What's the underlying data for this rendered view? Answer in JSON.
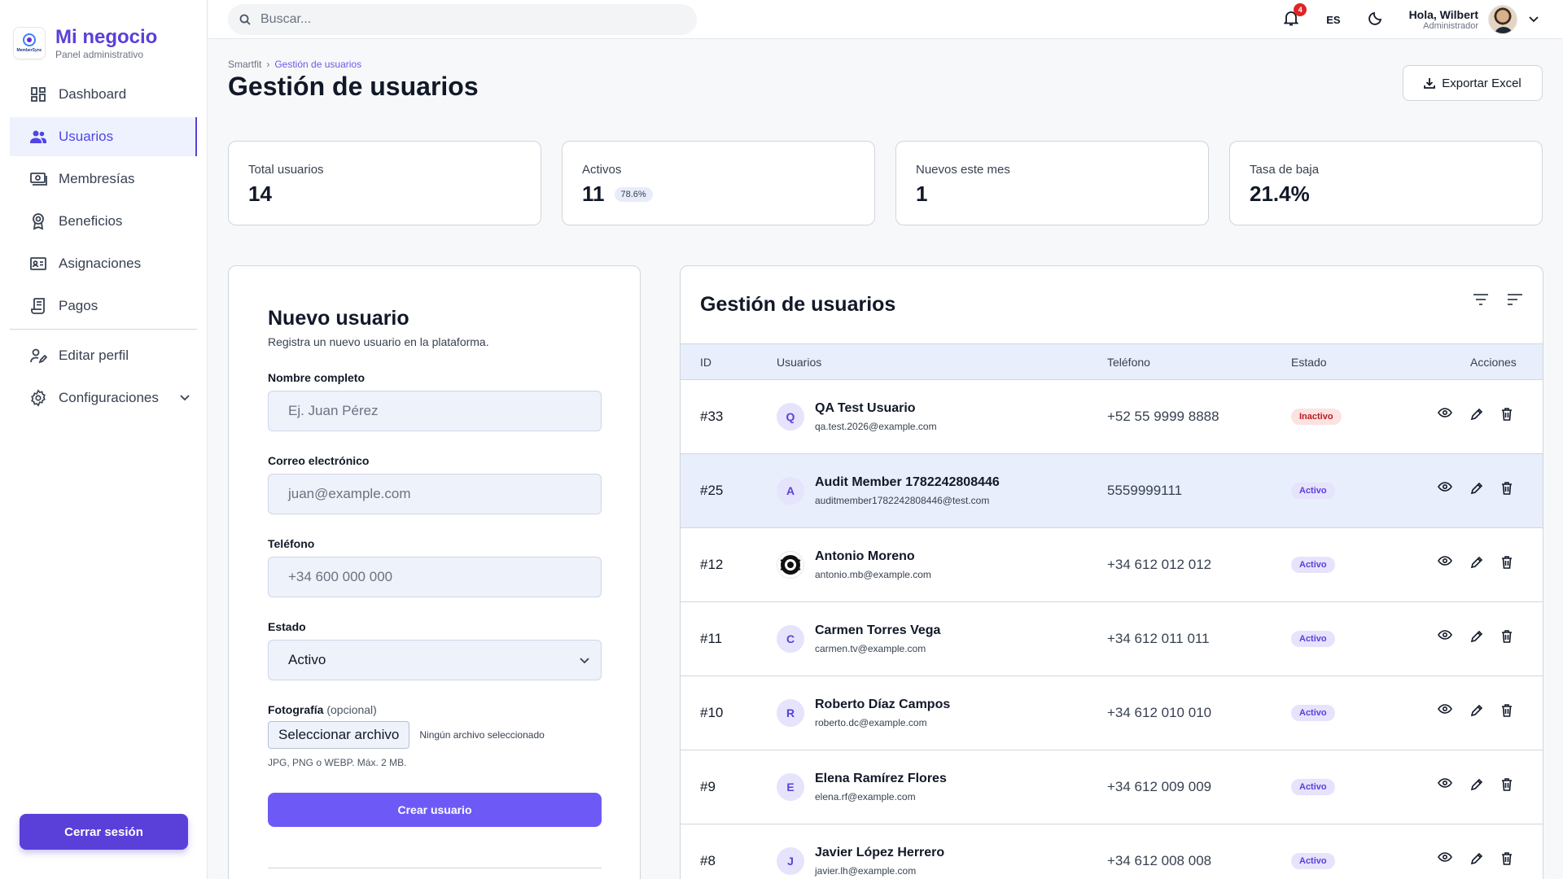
{
  "brand": {
    "title": "Mi negocio",
    "subtitle": "Panel administrativo",
    "logo_text": "MemberSync"
  },
  "sidebar": {
    "items": [
      {
        "label": "Dashboard",
        "icon": "dashboard-icon",
        "active": false
      },
      {
        "label": "Usuarios",
        "icon": "users-icon",
        "active": true
      },
      {
        "label": "Membresías",
        "icon": "membership-icon",
        "active": false
      },
      {
        "label": "Beneficios",
        "icon": "award-icon",
        "active": false
      },
      {
        "label": "Asignaciones",
        "icon": "id-card-icon",
        "active": false
      },
      {
        "label": "Pagos",
        "icon": "receipt-icon",
        "active": false
      }
    ],
    "secondary": [
      {
        "label": "Editar perfil",
        "icon": "user-edit-icon"
      },
      {
        "label": "Configuraciones",
        "icon": "gear-icon"
      }
    ],
    "logout_label": "Cerrar sesión"
  },
  "topbar": {
    "search_placeholder": "Buscar...",
    "notification_count": "4",
    "language": "ES",
    "user_greeting": "Hola, Wilbert",
    "user_role": "Administrador"
  },
  "page": {
    "breadcrumb": [
      "Smartfit",
      "Gestión de usuarios"
    ],
    "title": "Gestión de usuarios",
    "export_label": "Exportar Excel"
  },
  "stats": [
    {
      "label": "Total usuarios",
      "value": "14",
      "chip": ""
    },
    {
      "label": "Activos",
      "value": "11",
      "chip": "78.6%"
    },
    {
      "label": "Nuevos este mes",
      "value": "1",
      "chip": ""
    },
    {
      "label": "Tasa de baja",
      "value": "21.4%",
      "chip": ""
    }
  ],
  "form": {
    "title": "Nuevo usuario",
    "subtitle": "Registra un nuevo usuario en la plataforma.",
    "name_label": "Nombre completo",
    "name_placeholder": "Ej. Juan Pérez",
    "email_label": "Correo electrónico",
    "email_placeholder": "juan@example.com",
    "phone_label": "Teléfono",
    "phone_placeholder": "+34 600 000 000",
    "status_label": "Estado",
    "status_value": "Activo",
    "photo_label": "Fotografía",
    "photo_optional": "(opcional)",
    "file_button": "Seleccionar archivo",
    "file_none": "Ningún archivo seleccionado",
    "file_hint": "JPG, PNG o WEBP. Máx. 2 MB.",
    "submit_label": "Crear usuario"
  },
  "table": {
    "title": "Gestión de usuarios",
    "columns": [
      "ID",
      "Usuarios",
      "Teléfono",
      "Estado",
      "Acciones"
    ],
    "rows": [
      {
        "id": "#33",
        "initial": "Q",
        "name": "QA Test Usuario",
        "email": "qa.test.2026@example.com",
        "phone": "+52 55 9999 8888",
        "status": "Inactivo"
      },
      {
        "id": "#25",
        "initial": "A",
        "name": "Audit Member 1782242808446",
        "email": "auditmember1782242808446@test.com",
        "phone": "5559999111",
        "status": "Activo"
      },
      {
        "id": "#12",
        "initial": "",
        "name": "Antonio Moreno",
        "email": "antonio.mb@example.com",
        "phone": "+34 612 012 012",
        "status": "Activo"
      },
      {
        "id": "#11",
        "initial": "C",
        "name": "Carmen Torres Vega",
        "email": "carmen.tv@example.com",
        "phone": "+34 612 011 011",
        "status": "Activo"
      },
      {
        "id": "#10",
        "initial": "R",
        "name": "Roberto Díaz Campos",
        "email": "roberto.dc@example.com",
        "phone": "+34 612 010 010",
        "status": "Activo"
      },
      {
        "id": "#9",
        "initial": "E",
        "name": "Elena Ramírez Flores",
        "email": "elena.rf@example.com",
        "phone": "+34 612 009 009",
        "status": "Activo"
      },
      {
        "id": "#8",
        "initial": "J",
        "name": "Javier López Herrero",
        "email": "javier.lh@example.com",
        "phone": "+34 612 008 008",
        "status": "Activo"
      }
    ]
  },
  "colors": {
    "accent": "#5b3fd9",
    "button": "#6d5af6",
    "active_bg": "#e6e3fc",
    "inactive_bg": "#fde2e2"
  }
}
